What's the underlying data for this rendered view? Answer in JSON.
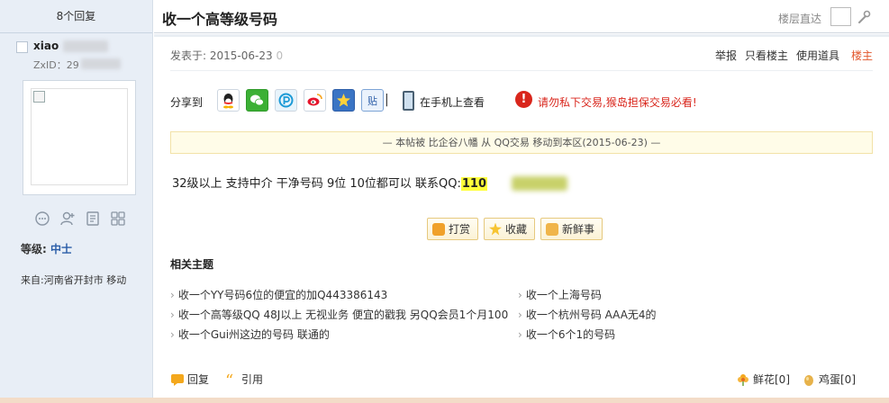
{
  "author": {
    "reply_count": "8个回复",
    "name_visible": "xiao",
    "id_prefix": "ZxID：29",
    "level_label": "等级:",
    "level_value": "中士",
    "from": "来自:河南省开封市 移动",
    "icons": [
      "chat-icon",
      "add-friend-icon",
      "profile-icon",
      "grid-icon"
    ]
  },
  "header": {
    "title": "收一个高等级号码",
    "floor_jump_label": "楼层直达"
  },
  "post_meta": {
    "posted_label": "发表于: 2015-06-23",
    "posted_zero": "0",
    "report": "举报",
    "only_op": "只看楼主",
    "use_tool": "使用道具",
    "op_badge": "楼主"
  },
  "share": {
    "label": "分享到",
    "icons": [
      "qq-icon",
      "wechat-icon",
      "pengyou-icon",
      "weibo-icon",
      "favorite-star-icon",
      "tieba-icon"
    ],
    "divider": "|",
    "mobile_label": "在手机上查看",
    "warning": "请勿私下交易,猴岛担保交易必看!"
  },
  "notice": "— 本帖被 比企谷八幡 从 QQ交易 移动到本区(2015-06-23) —",
  "body": {
    "text": "32级以上  支持中介 干净号码  9位 10位都可以 联系QQ:",
    "qq_visible": "110"
  },
  "actions": {
    "reward": "打赏",
    "collect": "收藏",
    "fresh": "新鲜事"
  },
  "related": {
    "title": "相关主题",
    "left": [
      "收一个YY号码6位的便宜的加Q443386143",
      "收一个高等级QQ 48J以上 无视业务 便宜的戳我  另QQ会员1个月100",
      "收一个Gui州这边的号码 联通的"
    ],
    "right": [
      "收一个上海号码",
      "收一个杭州号码 AAA无4的",
      "收一个6个1的号码"
    ]
  },
  "footer": {
    "reply": "回复",
    "quote": "引用",
    "flower": "鲜花[0]",
    "egg": "鸡蛋[0]"
  },
  "colors": {
    "sidebar_bg": "#e8eef6",
    "accent_red": "#d9261c",
    "op_orange": "#e2562c",
    "highlight": "#ffff3a",
    "notice_bg": "#fffce8"
  }
}
